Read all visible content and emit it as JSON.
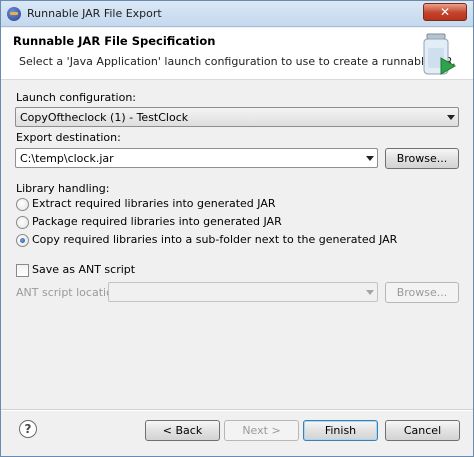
{
  "window": {
    "title": "Runnable JAR File Export",
    "close_symbol": "✕"
  },
  "header": {
    "title": "Runnable JAR File Specification",
    "description": "Select a 'Java Application' launch configuration to use to create a runnable JAR."
  },
  "launch": {
    "label": "Launch configuration:",
    "value": "CopyOftheclock (1) - TestClock"
  },
  "export": {
    "label": "Export destination:",
    "value": "C:\\temp\\clock.jar",
    "browse": "Browse..."
  },
  "library": {
    "label": "Library handling:",
    "options": [
      {
        "label": "Extract required libraries into generated JAR",
        "checked": false
      },
      {
        "label": "Package required libraries into generated JAR",
        "checked": false
      },
      {
        "label": "Copy required libraries into a sub-folder next to the generated JAR",
        "checked": true
      }
    ]
  },
  "ant": {
    "checkbox_label": "Save as ANT script",
    "checked": false,
    "location_label": "ANT script location:",
    "location_value": "",
    "browse": "Browse..."
  },
  "footer": {
    "help": "?",
    "back": "< Back",
    "next": "Next >",
    "finish": "Finish",
    "cancel": "Cancel"
  }
}
